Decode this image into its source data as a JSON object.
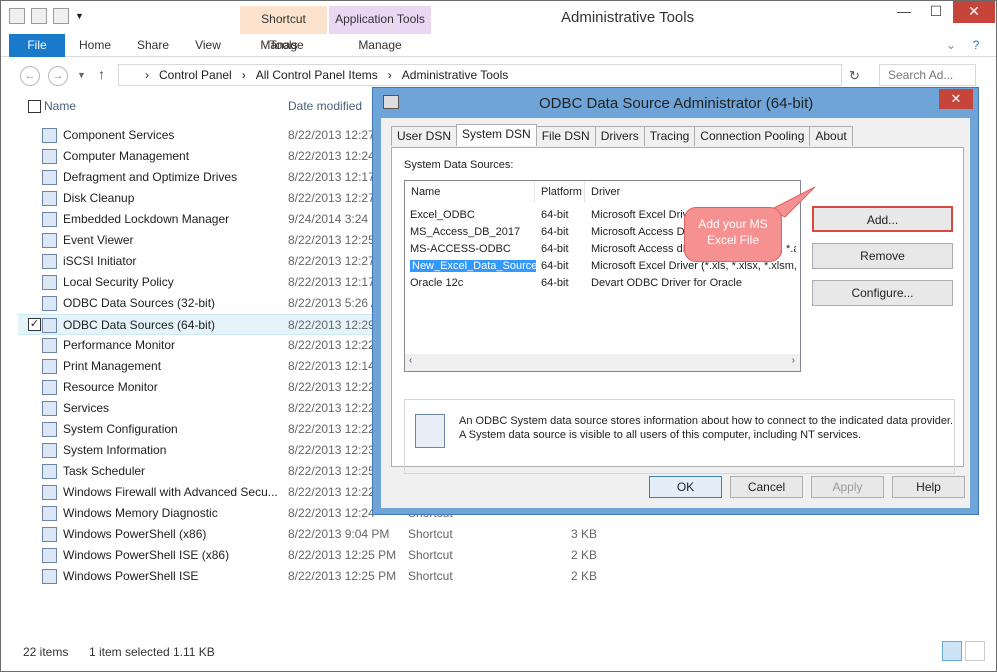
{
  "window": {
    "title": "Administrative Tools",
    "contextual_tabs": [
      "Shortcut Tools",
      "Application Tools"
    ],
    "ribbon_tabs": [
      "File",
      "Home",
      "Share",
      "View",
      "Manage",
      "Manage"
    ]
  },
  "address": {
    "crumbs": [
      "Control Panel",
      "All Control Panel Items",
      "Administrative Tools"
    ],
    "search_placeholder": "Search Ad..."
  },
  "columns": {
    "name": "Name",
    "date": "Date modified"
  },
  "files": [
    {
      "name": "Component Services",
      "date": "8/22/2013 12:27",
      "type": "",
      "size": ""
    },
    {
      "name": "Computer Management",
      "date": "8/22/2013 12:24",
      "type": "",
      "size": ""
    },
    {
      "name": "Defragment and Optimize Drives",
      "date": "8/22/2013 12:17",
      "type": "",
      "size": ""
    },
    {
      "name": "Disk Cleanup",
      "date": "8/22/2013 12:27",
      "type": "",
      "size": ""
    },
    {
      "name": "Embedded Lockdown Manager",
      "date": "9/24/2014 3:24 P",
      "type": "",
      "size": ""
    },
    {
      "name": "Event Viewer",
      "date": "8/22/2013 12:25",
      "type": "",
      "size": ""
    },
    {
      "name": "iSCSI Initiator",
      "date": "8/22/2013 12:27",
      "type": "",
      "size": ""
    },
    {
      "name": "Local Security Policy",
      "date": "8/22/2013 12:17",
      "type": "",
      "size": ""
    },
    {
      "name": "ODBC Data Sources (32-bit)",
      "date": "8/22/2013 5:26 A",
      "type": "",
      "size": ""
    },
    {
      "name": "ODBC Data Sources (64-bit)",
      "date": "8/22/2013 12:29",
      "type": "",
      "size": ""
    },
    {
      "name": "Performance Monitor",
      "date": "8/22/2013 12:22",
      "type": "",
      "size": ""
    },
    {
      "name": "Print Management",
      "date": "8/22/2013 12:14",
      "type": "",
      "size": ""
    },
    {
      "name": "Resource Monitor",
      "date": "8/22/2013 12:22",
      "type": "",
      "size": ""
    },
    {
      "name": "Services",
      "date": "8/22/2013 12:22",
      "type": "",
      "size": ""
    },
    {
      "name": "System Configuration",
      "date": "8/22/2013 12:22",
      "type": "",
      "size": ""
    },
    {
      "name": "System Information",
      "date": "8/22/2013 12:23",
      "type": "",
      "size": ""
    },
    {
      "name": "Task Scheduler",
      "date": "8/22/2013 12:25",
      "type": "",
      "size": ""
    },
    {
      "name": "Windows Firewall with Advanced Secu...",
      "date": "8/22/2013 12:22",
      "type": "",
      "size": ""
    },
    {
      "name": "Windows Memory Diagnostic",
      "date": "8/22/2013 12:24",
      "type": "Shortcut",
      "size": ""
    },
    {
      "name": "Windows PowerShell (x86)",
      "date": "8/22/2013 9:04 PM",
      "type": "Shortcut",
      "size": "3 KB"
    },
    {
      "name": "Windows PowerShell ISE (x86)",
      "date": "8/22/2013 12:25 PM",
      "type": "Shortcut",
      "size": "2 KB"
    },
    {
      "name": "Windows PowerShell ISE",
      "date": "8/22/2013 12:25 PM",
      "type": "Shortcut",
      "size": "2 KB"
    }
  ],
  "status": {
    "count": "22 items",
    "selected": "1 item selected",
    "size": "1.11 KB"
  },
  "dialog": {
    "title": "ODBC Data Source Administrator (64-bit)",
    "tabs": [
      "User DSN",
      "System DSN",
      "File DSN",
      "Drivers",
      "Tracing",
      "Connection Pooling",
      "About"
    ],
    "section_label": "System Data Sources:",
    "headers": [
      "Name",
      "Platform",
      "Driver"
    ],
    "sources": [
      {
        "name": "Excel_ODBC",
        "platform": "64-bit",
        "driver": "Microsoft Excel Driver (*.xls, *.xlsx, *.x"
      },
      {
        "name": "MS_Access_DB_2017",
        "platform": "64-bit",
        "driver": "Microsoft Access Driver"
      },
      {
        "name": "MS-ACCESS-ODBC",
        "platform": "64-bit",
        "driver": "Microsoft Access dBASE Driver (*.mdb, *.acc"
      },
      {
        "name": "New_Excel_Data_Source",
        "platform": "64-bit",
        "driver": "Microsoft Excel Driver (*.xls, *.xlsx, *.xlsm, *.x"
      },
      {
        "name": "Oracle 12c",
        "platform": "64-bit",
        "driver": "Devart ODBC Driver for Oracle"
      }
    ],
    "buttons": {
      "add": "Add...",
      "remove": "Remove",
      "configure": "Configure...",
      "ok": "OK",
      "cancel": "Cancel",
      "apply": "Apply",
      "help": "Help"
    },
    "info_line1": "An ODBC System data source stores information about how to connect to the indicated data provider.",
    "info_line2": "A System data source is visible to all users of this computer, including NT services.",
    "callout": "Add your MS Excel File"
  }
}
